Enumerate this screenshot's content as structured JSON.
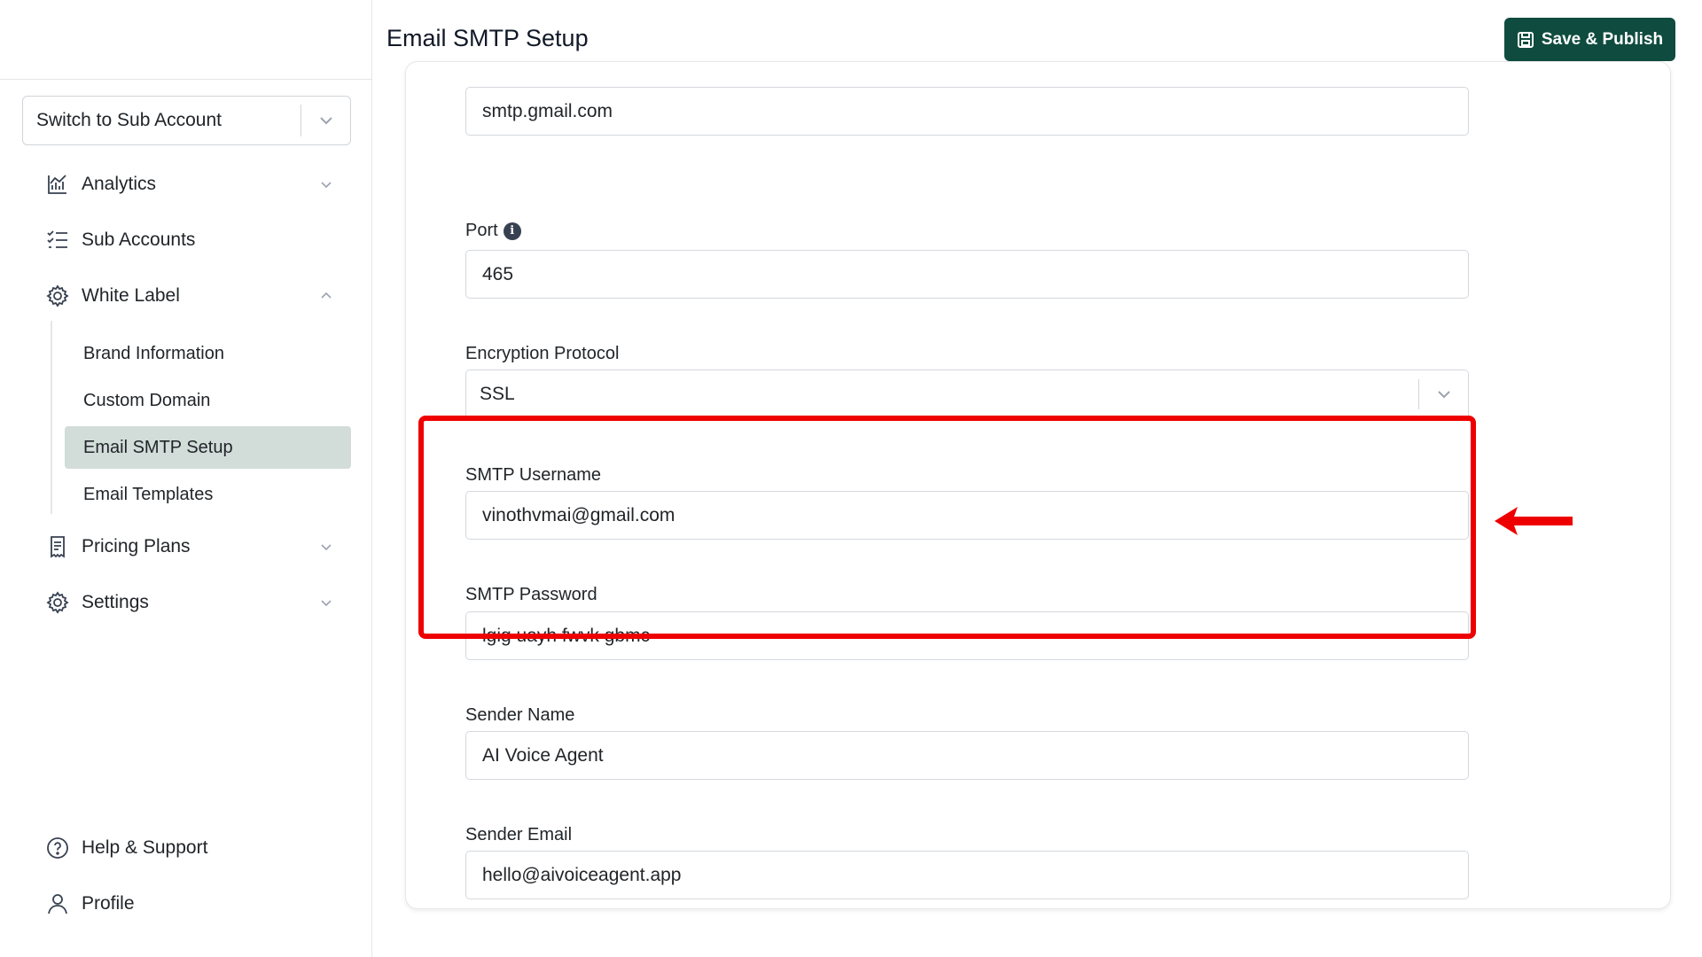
{
  "header": {
    "title": "Email SMTP Setup",
    "save_label": "Save & Publish"
  },
  "sidebar": {
    "switch_label": "Switch to Sub Account",
    "nav": {
      "analytics": "Analytics",
      "sub_accounts": "Sub Accounts",
      "white_label": "White Label",
      "pricing_plans": "Pricing Plans",
      "settings": "Settings",
      "help": "Help & Support",
      "profile": "Profile"
    },
    "white_label_items": [
      "Brand Information",
      "Custom Domain",
      "Email SMTP Setup",
      "Email Templates"
    ],
    "active_item": "Email SMTP Setup"
  },
  "form": {
    "host_value": "smtp.gmail.com",
    "port_label": "Port",
    "port_value": "465",
    "encryption_label": "Encryption Protocol",
    "encryption_value": "SSL",
    "username_label": "SMTP Username",
    "username_value": "vinothvmai@gmail.com",
    "password_label": "SMTP Password",
    "password_value": "lgig uayh fwvk gbmc",
    "sender_name_label": "Sender Name",
    "sender_name_value": "AI Voice Agent",
    "sender_email_label": "Sender Email",
    "sender_email_value": "hello@aivoiceagent.app"
  },
  "colors": {
    "primary": "#0f4c3f",
    "active_bg": "#d2dcd9",
    "annotation": "#ee0000"
  },
  "icons": {
    "analytics": "bar-chart-icon",
    "sub_accounts": "checklist-icon",
    "white_label": "gear-icon",
    "pricing_plans": "receipt-icon",
    "settings": "gear-icon",
    "help": "question-circle-icon",
    "profile": "user-icon",
    "save": "save-icon",
    "info": "info-icon"
  }
}
